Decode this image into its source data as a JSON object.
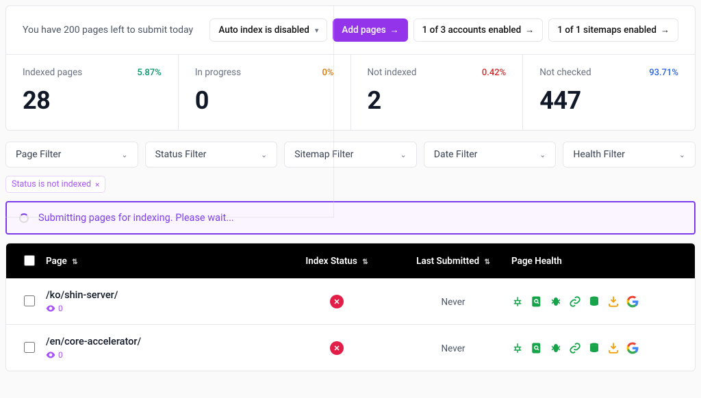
{
  "quota_text": "You have 200 pages left to submit today",
  "actions": {
    "auto_index": "Auto index is disabled",
    "add_pages": "Add pages",
    "accounts": "1 of 3 accounts enabled",
    "sitemaps": "1 of 1 sitemaps enabled"
  },
  "stats": {
    "indexed": {
      "label": "Indexed pages",
      "pct": "5.87%",
      "pct_class": "green",
      "value": "28"
    },
    "in_progress": {
      "label": "In progress",
      "pct": "0%",
      "pct_class": "amber",
      "value": "0"
    },
    "not_indexed": {
      "label": "Not indexed",
      "pct": "0.42%",
      "pct_class": "red",
      "value": "2"
    },
    "not_checked": {
      "label": "Not checked",
      "pct": "93.71%",
      "pct_class": "blue",
      "value": "447"
    }
  },
  "filters": {
    "page": "Page Filter",
    "status": "Status Filter",
    "sitemap": "Sitemap Filter",
    "date": "Date Filter",
    "health": "Health Filter"
  },
  "active_chip": "Status is not indexed",
  "banner_text": "Submitting pages for indexing. Please wait...",
  "columns": {
    "page": "Page",
    "index_status": "Index Status",
    "last_submitted": "Last Submitted",
    "page_health": "Page Health"
  },
  "rows": [
    {
      "path": "/ko/shin-server/",
      "views": "0",
      "last": "Never"
    },
    {
      "path": "/en/core-accelerator/",
      "views": "0",
      "last": "Never"
    }
  ]
}
